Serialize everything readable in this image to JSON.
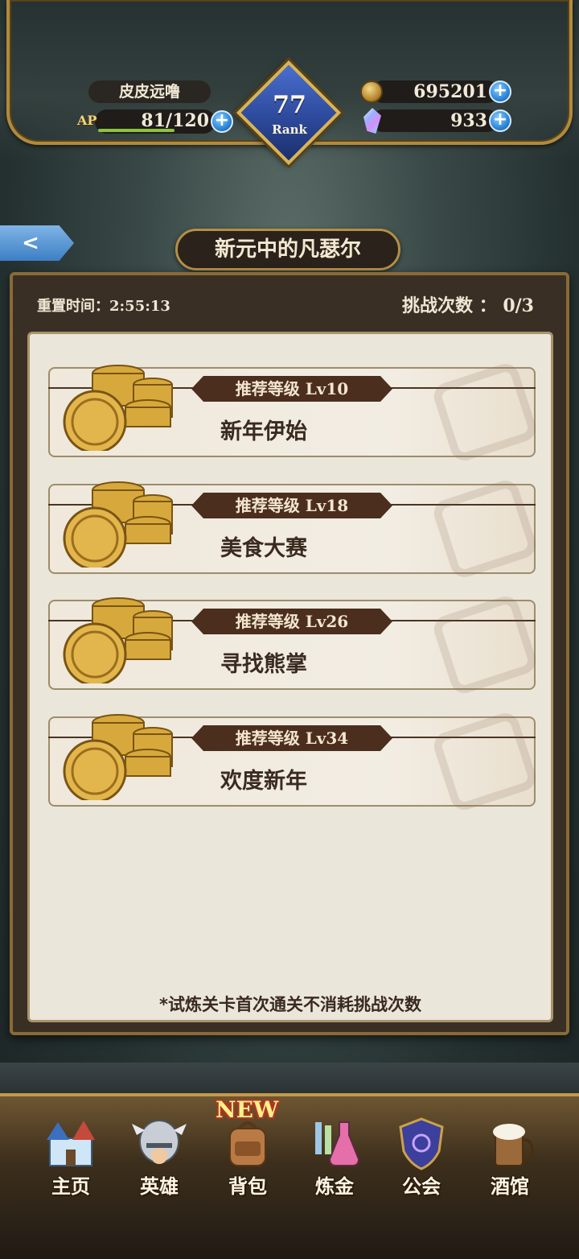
{
  "header": {
    "player_name": "皮皮远噜",
    "ap_label": "AP",
    "ap_value": "81/120",
    "ap_fraction": 0.675,
    "rank_level": "77",
    "rank_label": "Rank",
    "gold": "695201",
    "crystal": "933",
    "plus_symbol": "+"
  },
  "page": {
    "back_symbol": "<",
    "title": "新元中的凡瑟尔",
    "reset_time": "重置时间：2:55:13",
    "challenge_count": "挑战次数 ： 0/3",
    "note": "*试炼关卡首次通关不消耗挑战次数"
  },
  "stages": [
    {
      "level_tag": "推荐等级  Lv10",
      "name": "新年伊始"
    },
    {
      "level_tag": "推荐等级  Lv18",
      "name": "美食大赛"
    },
    {
      "level_tag": "推荐等级  Lv26",
      "name": "寻找熊掌"
    },
    {
      "level_tag": "推荐等级  Lv34",
      "name": "欢度新年"
    }
  ],
  "nav": {
    "new_badge": "NEW",
    "items": [
      {
        "label": "主页",
        "icon": "castle-icon"
      },
      {
        "label": "英雄",
        "icon": "knight-helmet-icon"
      },
      {
        "label": "背包",
        "icon": "backpack-icon"
      },
      {
        "label": "炼金",
        "icon": "potion-icon"
      },
      {
        "label": "公会",
        "icon": "guild-shield-icon"
      },
      {
        "label": "酒馆",
        "icon": "tavern-mug-icon"
      }
    ]
  },
  "colors": {
    "gold_trim": "#b08a3e",
    "panel_bg": "#3a2f25",
    "tag_bg": "#4b2e1e",
    "plus_blue": "#2c86d8"
  }
}
